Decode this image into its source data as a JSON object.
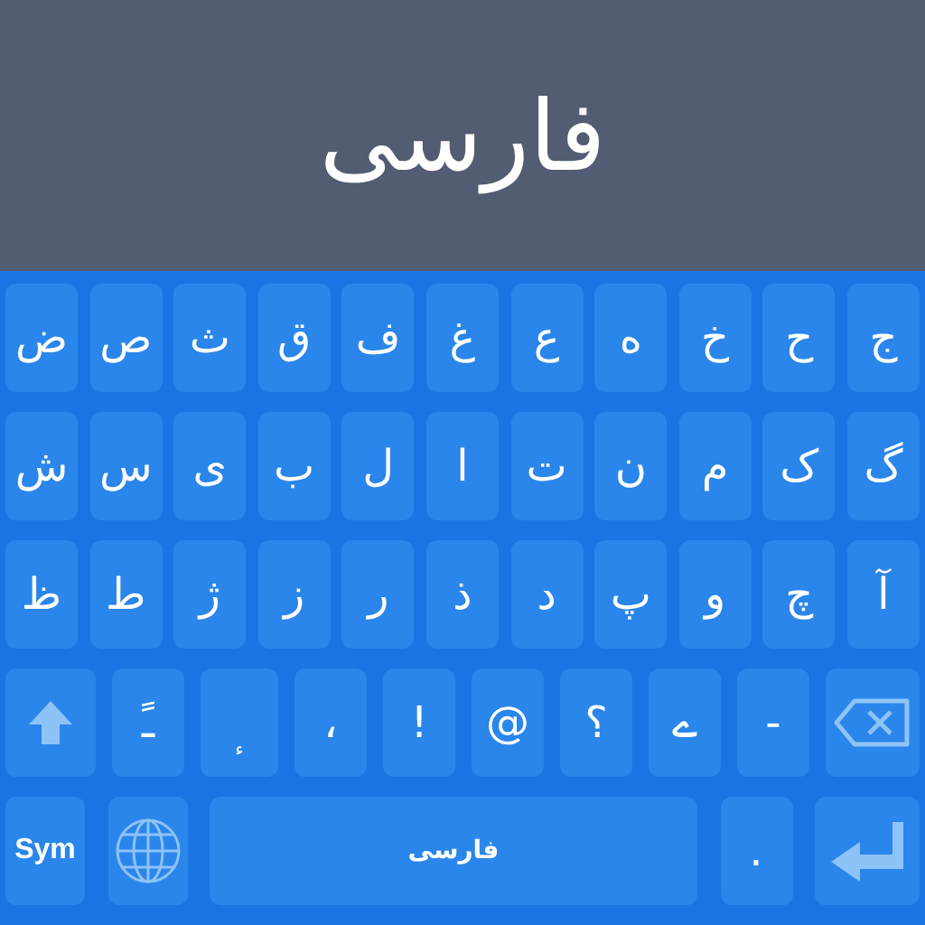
{
  "header": {
    "title": "فارسی"
  },
  "rows": [
    {
      "keys": [
        {
          "kind": "char",
          "label": "ج"
        },
        {
          "kind": "char",
          "label": "ح"
        },
        {
          "kind": "char",
          "label": "خ"
        },
        {
          "kind": "char",
          "label": "ه"
        },
        {
          "kind": "char",
          "label": "ع"
        },
        {
          "kind": "char",
          "label": "غ"
        },
        {
          "kind": "char",
          "label": "ف"
        },
        {
          "kind": "char",
          "label": "ق"
        },
        {
          "kind": "char",
          "label": "ث"
        },
        {
          "kind": "char",
          "label": "ص"
        },
        {
          "kind": "char",
          "label": "ض"
        }
      ]
    },
    {
      "keys": [
        {
          "kind": "char",
          "label": "گ"
        },
        {
          "kind": "char",
          "label": "ک"
        },
        {
          "kind": "char",
          "label": "م"
        },
        {
          "kind": "char",
          "label": "ن"
        },
        {
          "kind": "char",
          "label": "ت"
        },
        {
          "kind": "char",
          "label": "ا"
        },
        {
          "kind": "char",
          "label": "ل"
        },
        {
          "kind": "char",
          "label": "ب"
        },
        {
          "kind": "char",
          "label": "ی"
        },
        {
          "kind": "char",
          "label": "س"
        },
        {
          "kind": "char",
          "label": "ش"
        }
      ]
    },
    {
      "keys": [
        {
          "kind": "char",
          "label": "آ"
        },
        {
          "kind": "char",
          "label": "چ"
        },
        {
          "kind": "char",
          "label": "و"
        },
        {
          "kind": "char",
          "label": "پ"
        },
        {
          "kind": "char",
          "label": "د"
        },
        {
          "kind": "char",
          "label": "ذ"
        },
        {
          "kind": "char",
          "label": "ر"
        },
        {
          "kind": "char",
          "label": "ز"
        },
        {
          "kind": "char",
          "label": "ژ"
        },
        {
          "kind": "char",
          "label": "ط"
        },
        {
          "kind": "char",
          "label": "ظ"
        }
      ]
    },
    {
      "keys": [
        {
          "kind": "backspace"
        },
        {
          "kind": "char",
          "label": "-"
        },
        {
          "kind": "char",
          "label": "ے"
        },
        {
          "kind": "char",
          "label": "؟"
        },
        {
          "kind": "char",
          "label": "@"
        },
        {
          "kind": "char",
          "label": "!"
        },
        {
          "kind": "char",
          "label": "،"
        },
        {
          "kind": "small",
          "label": "ء"
        },
        {
          "kind": "char",
          "label": "ـً"
        },
        {
          "kind": "shift"
        }
      ]
    },
    {
      "keys": [
        {
          "kind": "enter"
        },
        {
          "kind": "char",
          "label": "."
        },
        {
          "kind": "space",
          "label": "فارسی"
        },
        {
          "kind": "globe"
        },
        {
          "kind": "sym",
          "label": "Sym"
        }
      ]
    }
  ]
}
